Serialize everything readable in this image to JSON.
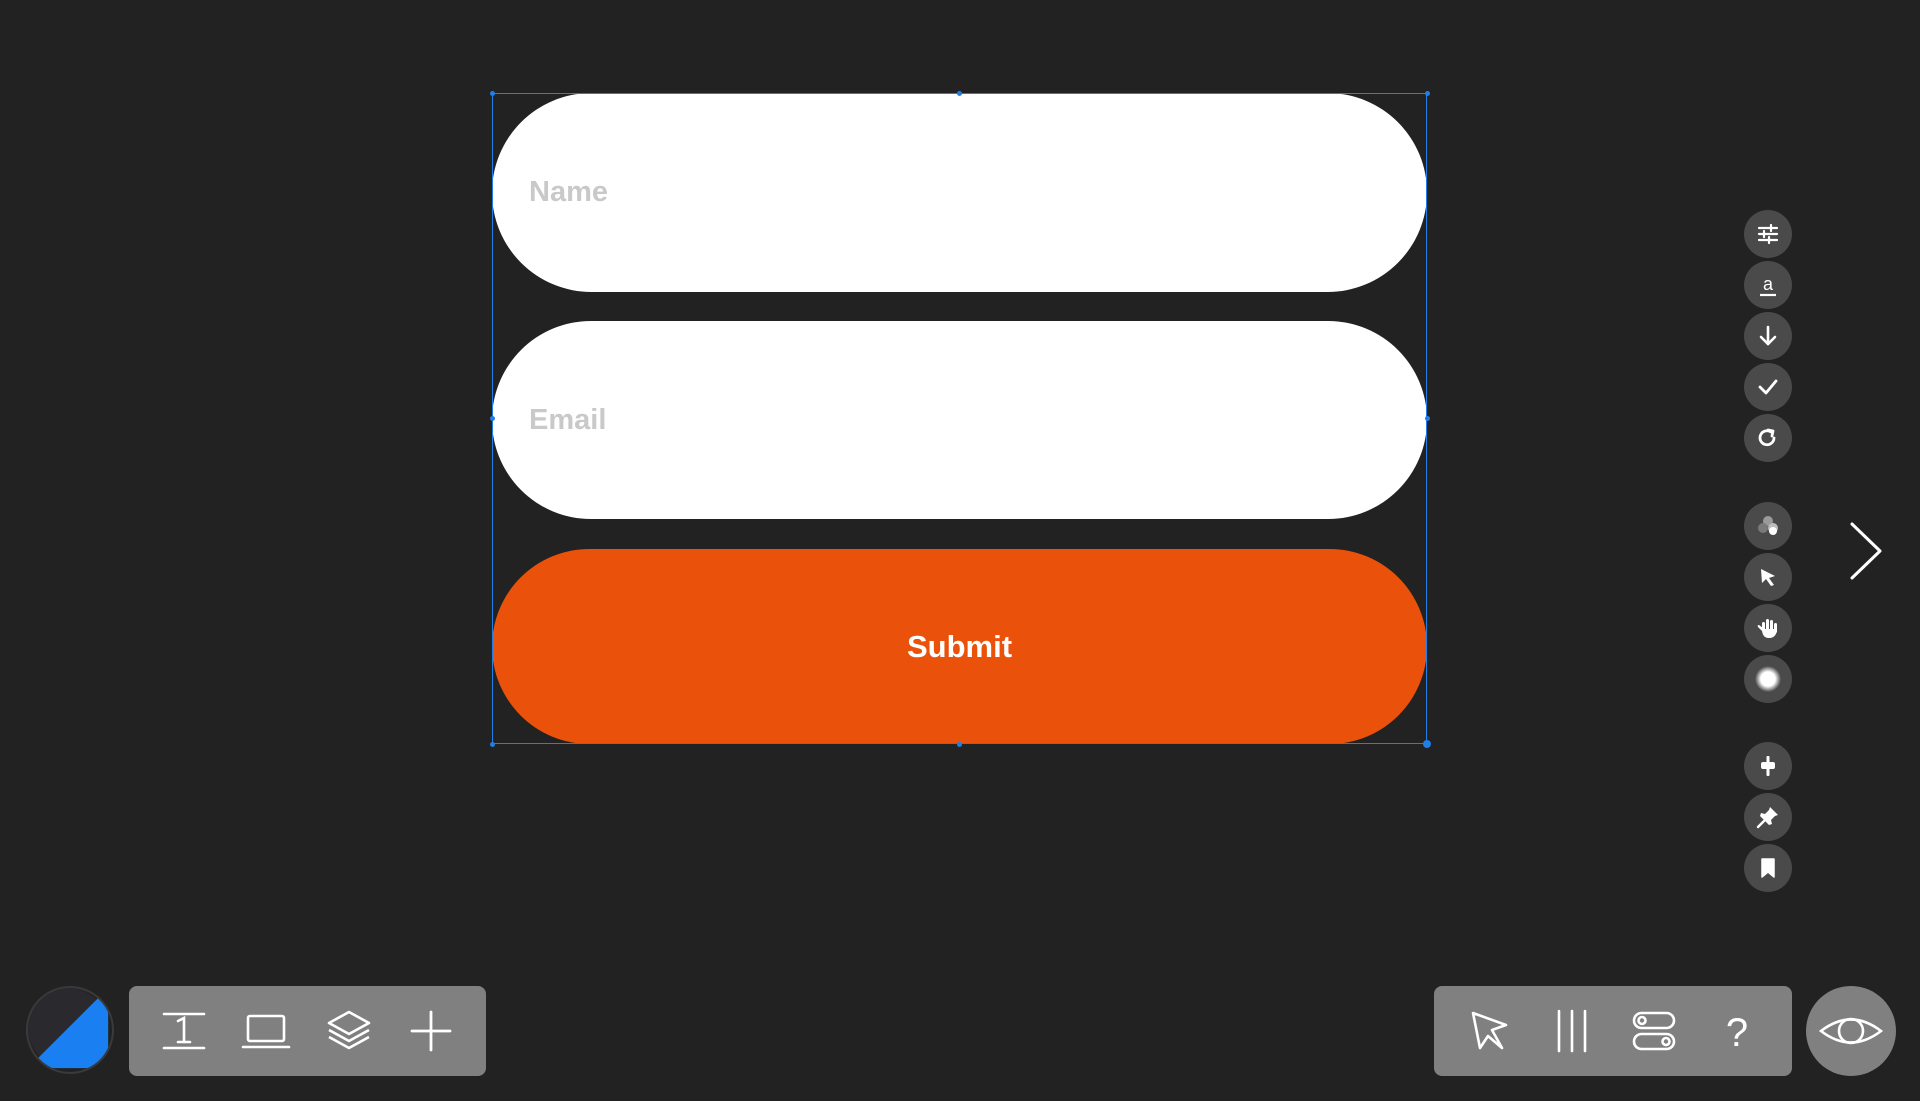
{
  "form": {
    "name_placeholder": "Name",
    "email_placeholder": "Email",
    "submit_label": "Submit"
  },
  "colors": {
    "background": "#222222",
    "selection": "#1f7fe6",
    "submit": "#ea520b",
    "field": "#ffffff",
    "placeholder": "#c9c9c9",
    "toolbar": "#808080",
    "tool_circle": "#4a4a4a"
  },
  "right_tools": [
    {
      "icon": "sliders-icon"
    },
    {
      "icon": "text-style-icon"
    },
    {
      "icon": "arrow-down-icon"
    },
    {
      "icon": "checkmark-icon"
    },
    {
      "icon": "redo-icon"
    },
    {
      "icon": "color-blend-icon"
    },
    {
      "icon": "pointer-icon"
    },
    {
      "icon": "hand-icon"
    },
    {
      "icon": "blur-icon"
    },
    {
      "icon": "align-center-icon"
    },
    {
      "icon": "pin-icon"
    },
    {
      "icon": "bookmark-icon"
    }
  ],
  "bottom_left_toolbar": [
    {
      "icon": "text-tool-icon"
    },
    {
      "icon": "device-icon"
    },
    {
      "icon": "layers-icon"
    },
    {
      "icon": "add-icon"
    }
  ],
  "bottom_right_toolbar": [
    {
      "icon": "select-tool-icon"
    },
    {
      "icon": "columns-icon"
    },
    {
      "icon": "toggles-icon"
    },
    {
      "icon": "help-icon"
    }
  ],
  "preview_icon": "eye-icon",
  "theme_toggle_icon": "theme-toggle-icon",
  "next_icon": "chevron-right-icon"
}
